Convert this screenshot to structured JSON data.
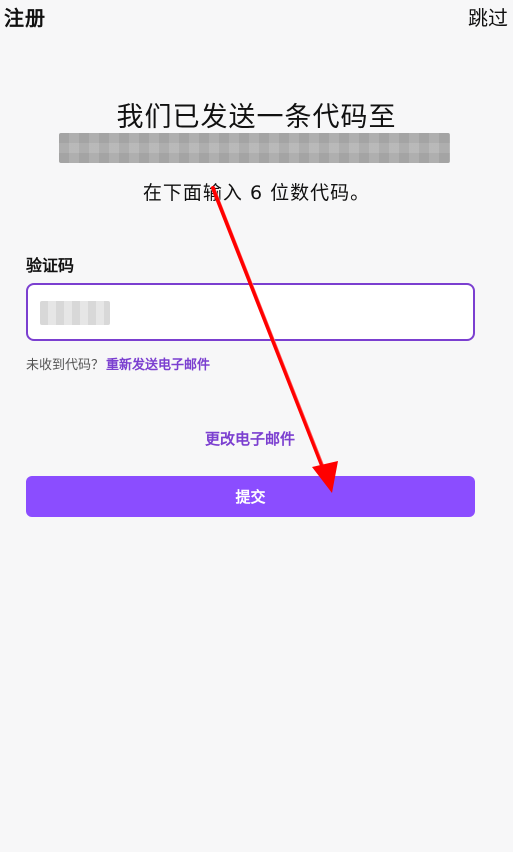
{
  "header": {
    "title": "注册",
    "skip_label": "跳过"
  },
  "main": {
    "headline": "我们已发送一条代码至",
    "subline": "在下面输入 6 位数代码。",
    "code_field": {
      "label": "验证码",
      "value": ""
    },
    "resend": {
      "prompt": "未收到代码？",
      "link_label": "重新发送电子邮件"
    },
    "change_email_label": "更改电子邮件",
    "submit_label": "提交"
  },
  "colors": {
    "accent": "#8b4dff",
    "accent_text": "#7b3fd0",
    "background": "#f7f7f8",
    "annotation": "#ff0000"
  },
  "icons": {
    "annotation": "red-arrow-icon"
  }
}
